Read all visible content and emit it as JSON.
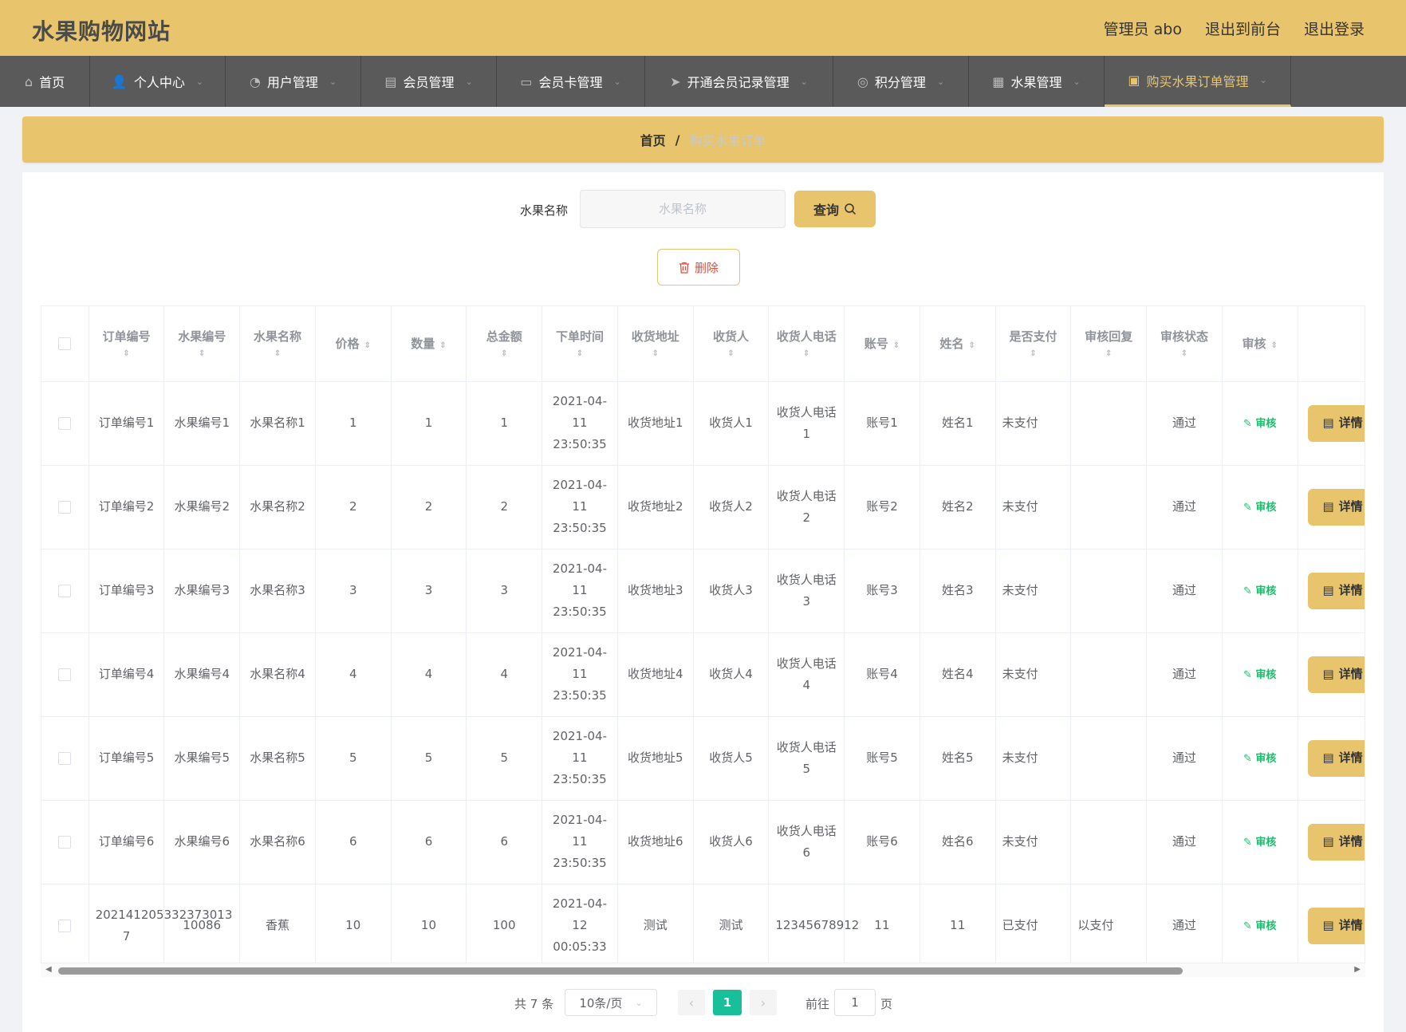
{
  "header": {
    "site_title": "水果购物网站",
    "admin_label": "管理员 abo",
    "to_front_label": "退出到前台",
    "logout_label": "退出登录"
  },
  "nav": {
    "items": [
      {
        "label": "首页",
        "icon": "home-icon"
      },
      {
        "label": "个人中心",
        "icon": "user-icon"
      },
      {
        "label": "用户管理",
        "icon": "gauge-icon"
      },
      {
        "label": "会员管理",
        "icon": "clipboard-icon"
      },
      {
        "label": "会员卡管理",
        "icon": "chat-icon"
      },
      {
        "label": "开通会员记录管理",
        "icon": "send-icon"
      },
      {
        "label": "积分管理",
        "icon": "lifebuoy-icon"
      },
      {
        "label": "水果管理",
        "icon": "grid-icon"
      },
      {
        "label": "购买水果订单管理",
        "icon": "briefcase-icon"
      }
    ],
    "active_index": 8
  },
  "breadcrumb": {
    "home": "首页",
    "separator": "/",
    "current": "购买水果订单"
  },
  "search": {
    "label": "水果名称",
    "placeholder": "水果名称",
    "value": "",
    "query_label": "查询"
  },
  "delete_label": "删除",
  "table": {
    "headers": [
      "订单编号",
      "水果编号",
      "水果名称",
      "价格",
      "数量",
      "总金额",
      "下单时间",
      "收货地址",
      "收货人",
      "收货人电话",
      "账号",
      "姓名",
      "是否支付",
      "审核回复",
      "审核状态",
      "审核"
    ],
    "audit_label": "审核",
    "detail_label": "详情",
    "rows": [
      {
        "order_no": "订单编号1",
        "fruit_no": "水果编号1",
        "fruit_name": "水果名称1",
        "price": "1",
        "qty": "1",
        "total": "1",
        "time": "2021-04-11 23:50:35",
        "address": "收货地址1",
        "receiver": "收货人1",
        "phone": "收货人电话1",
        "account": "账号1",
        "name": "姓名1",
        "paid": "未支付",
        "reply": "",
        "status": "通过"
      },
      {
        "order_no": "订单编号2",
        "fruit_no": "水果编号2",
        "fruit_name": "水果名称2",
        "price": "2",
        "qty": "2",
        "total": "2",
        "time": "2021-04-11 23:50:35",
        "address": "收货地址2",
        "receiver": "收货人2",
        "phone": "收货人电话2",
        "account": "账号2",
        "name": "姓名2",
        "paid": "未支付",
        "reply": "",
        "status": "通过"
      },
      {
        "order_no": "订单编号3",
        "fruit_no": "水果编号3",
        "fruit_name": "水果名称3",
        "price": "3",
        "qty": "3",
        "total": "3",
        "time": "2021-04-11 23:50:35",
        "address": "收货地址3",
        "receiver": "收货人3",
        "phone": "收货人电话3",
        "account": "账号3",
        "name": "姓名3",
        "paid": "未支付",
        "reply": "",
        "status": "通过"
      },
      {
        "order_no": "订单编号4",
        "fruit_no": "水果编号4",
        "fruit_name": "水果名称4",
        "price": "4",
        "qty": "4",
        "total": "4",
        "time": "2021-04-11 23:50:35",
        "address": "收货地址4",
        "receiver": "收货人4",
        "phone": "收货人电话4",
        "account": "账号4",
        "name": "姓名4",
        "paid": "未支付",
        "reply": "",
        "status": "通过"
      },
      {
        "order_no": "订单编号5",
        "fruit_no": "水果编号5",
        "fruit_name": "水果名称5",
        "price": "5",
        "qty": "5",
        "total": "5",
        "time": "2021-04-11 23:50:35",
        "address": "收货地址5",
        "receiver": "收货人5",
        "phone": "收货人电话5",
        "account": "账号5",
        "name": "姓名5",
        "paid": "未支付",
        "reply": "",
        "status": "通过"
      },
      {
        "order_no": "订单编号6",
        "fruit_no": "水果编号6",
        "fruit_name": "水果名称6",
        "price": "6",
        "qty": "6",
        "total": "6",
        "time": "2021-04-11 23:50:35",
        "address": "收货地址6",
        "receiver": "收货人6",
        "phone": "收货人电话6",
        "account": "账号6",
        "name": "姓名6",
        "paid": "未支付",
        "reply": "",
        "status": "通过"
      },
      {
        "order_no": "202141205332373013 7",
        "fruit_no": "10086",
        "fruit_name": "香蕉",
        "price": "10",
        "qty": "10",
        "total": "100",
        "time": "2021-04-12 00:05:33",
        "address": "测试",
        "receiver": "测试",
        "phone": "12345678912",
        "account": "11",
        "name": "11",
        "paid": "已支付",
        "reply": "以支付",
        "status": "通过"
      }
    ]
  },
  "pagination": {
    "total": "共 7 条",
    "page_size": "10条/页",
    "current_page": "1",
    "goto_label": "前往",
    "goto_value": "1",
    "page_suffix": "页"
  },
  "colors": {
    "accent": "#e8c46c",
    "nav_bg": "#5a5a5a",
    "audit": "#19be6b",
    "danger": "#e74c3c",
    "page_active": "#19be9b"
  }
}
